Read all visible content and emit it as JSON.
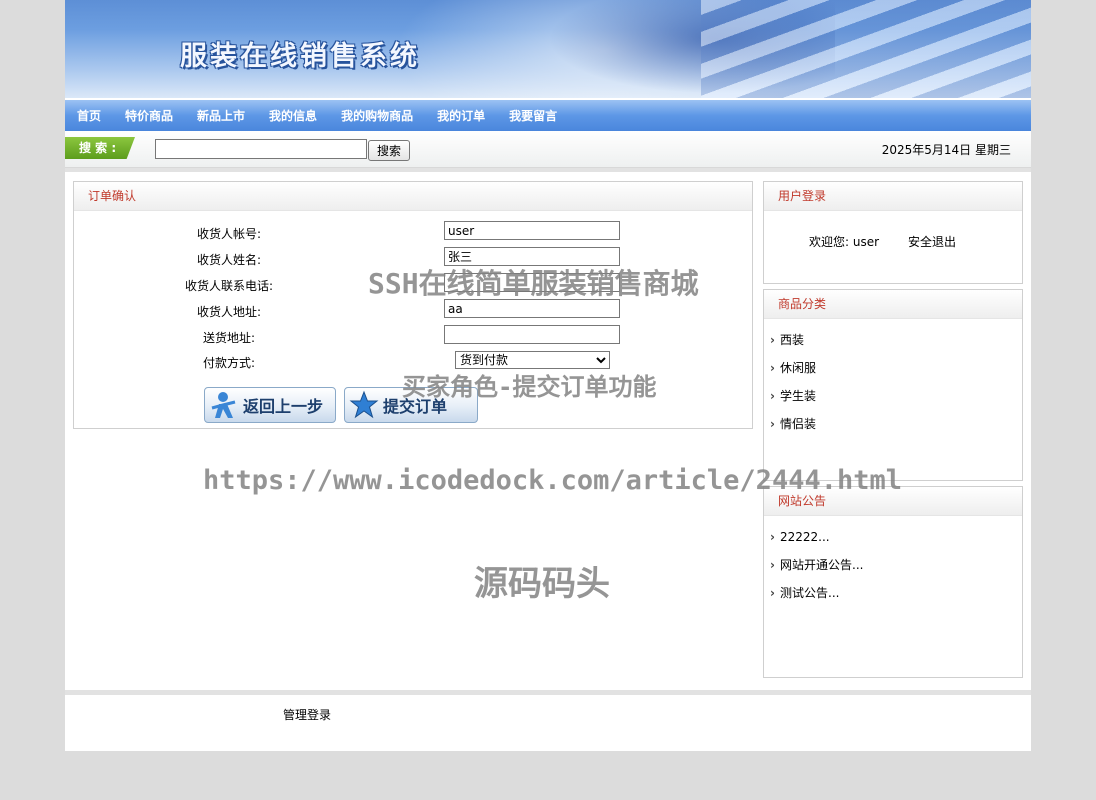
{
  "header": {
    "title": "服装在线销售系统"
  },
  "nav": {
    "items": [
      "首页",
      "特价商品",
      "新品上市",
      "我的信息",
      "我的购物商品",
      "我的订单",
      "我要留言"
    ]
  },
  "search": {
    "label": "搜 索 :",
    "value": "",
    "button": "搜索"
  },
  "date": "2025年5月14日 星期三",
  "order": {
    "heading": "订单确认",
    "fields": [
      {
        "label": "收货人帐号:",
        "value": "user"
      },
      {
        "label": "收货人姓名:",
        "value": "张三"
      },
      {
        "label": "收货人联系电话:",
        "value": ""
      },
      {
        "label": "收货人地址:",
        "value": "aa"
      },
      {
        "label": "送货地址:",
        "value": ""
      }
    ],
    "payment_label": "付款方式:",
    "payment_value": "货到付款",
    "back_button": "返回上一步",
    "submit_button": "提交订单"
  },
  "login": {
    "heading": "用户登录",
    "welcome": "欢迎您: user",
    "logout": "安全退出"
  },
  "categories": {
    "heading": "商品分类",
    "items": [
      "西装",
      "休闲服",
      "学生装",
      "情侣装"
    ]
  },
  "notices": {
    "heading": "网站公告",
    "items": [
      "22222...",
      "网站开通公告...",
      "测试公告..."
    ]
  },
  "footer": {
    "admin_link": "管理登录"
  },
  "watermarks": {
    "line1": "SSH在线简单服装销售商城",
    "line2": "买家角色-提交订单功能",
    "line3": "https://www.icodedock.com/article/2444.html",
    "line4": "源码码头"
  }
}
